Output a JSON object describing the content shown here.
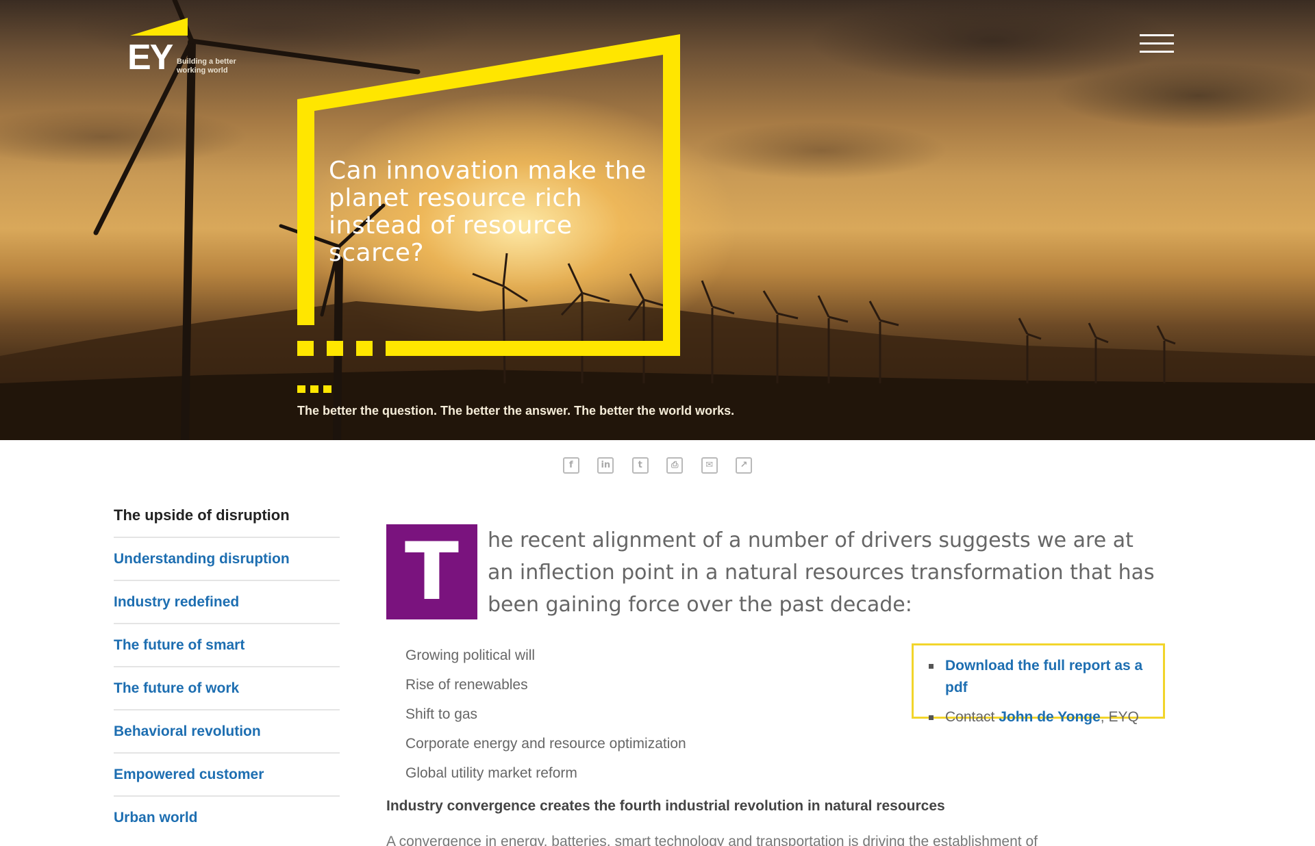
{
  "header": {
    "logo_mark": "EY",
    "logo_tagline": "Building a better working world",
    "menu_icon": "hamburger-menu-icon"
  },
  "hero": {
    "title": "Can innovation make the planet resource rich instead of resource scarce?",
    "tagline": "The better the question. The better the answer. The better the world works.",
    "accent_color": "#ffe600"
  },
  "share": {
    "icons": [
      "facebook-icon",
      "linkedin-icon",
      "twitter-icon",
      "print-icon",
      "email-icon",
      "share-icon"
    ],
    "glyphs": [
      "f",
      "in",
      "t",
      "⎙",
      "✉",
      "↗"
    ]
  },
  "sidebar": {
    "heading": "The upside of disruption",
    "items": [
      {
        "label": "Understanding disruption"
      },
      {
        "label": "Industry redefined"
      },
      {
        "label": "The future of smart"
      },
      {
        "label": "The future of work"
      },
      {
        "label": "Behavioral revolution"
      },
      {
        "label": "Empowered customer"
      },
      {
        "label": "Urban world"
      }
    ]
  },
  "article": {
    "dropcap": "T",
    "dropcap_color": "#7a137e",
    "lead": "he recent alignment of a number of drivers suggests we are at an inflection point in a natural resources transformation that has been gaining force over the past decade:",
    "drivers": [
      "Growing political will",
      "Rise of renewables",
      "Shift to gas",
      "Corporate energy and resource optimization",
      "Global utility market reform"
    ],
    "subheading": "Industry convergence creates the fourth industrial revolution in natural resources",
    "para_start": "A convergence in energy, batteries, smart technology and transportation is driving the establishment of"
  },
  "callout": {
    "download_label": "Download the full report as a pdf",
    "contact_prefix": "Contact ",
    "contact_name": "John de Yonge",
    "contact_suffix": ", EYQ"
  }
}
